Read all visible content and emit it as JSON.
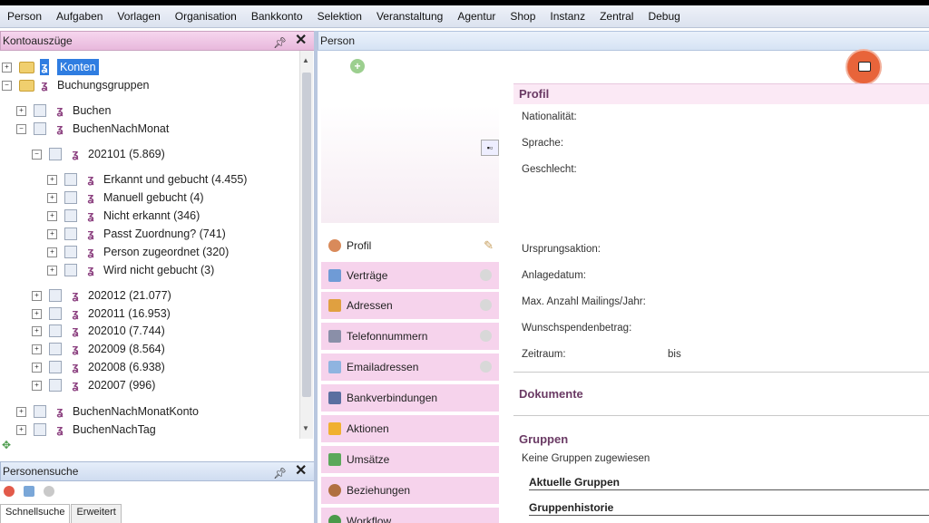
{
  "menu": [
    "Person",
    "Aufgaben",
    "Vorlagen",
    "Organisation",
    "Bankkonto",
    "Selektion",
    "Veranstaltung",
    "Agentur",
    "Shop",
    "Instanz",
    "Zentral",
    "Debug"
  ],
  "left_panel": {
    "title": "Kontoauszüge",
    "tree": [
      {
        "label": "Konten",
        "level": 0,
        "selected": true
      },
      {
        "label": "Buchungsgruppen",
        "level": 0
      },
      {
        "label": "Buchen",
        "level": 1
      },
      {
        "label": "BuchenNachMonat",
        "level": 1
      },
      {
        "label": "202101 (5.869)",
        "level": 2
      },
      {
        "label": "Erkannt und gebucht (4.455)",
        "level": 3
      },
      {
        "label": "Manuell gebucht (4)",
        "level": 3
      },
      {
        "label": "Nicht erkannt (346)",
        "level": 3
      },
      {
        "label": "Passt Zuordnung? (741)",
        "level": 3
      },
      {
        "label": "Person zugeordnet (320)",
        "level": 3
      },
      {
        "label": "Wird nicht gebucht (3)",
        "level": 3
      },
      {
        "label": "202012 (21.077)",
        "level": 2
      },
      {
        "label": "202011 (16.953)",
        "level": 2
      },
      {
        "label": "202010 (7.744)",
        "level": 2
      },
      {
        "label": "202009 (8.564)",
        "level": 2
      },
      {
        "label": "202008 (6.938)",
        "level": 2
      },
      {
        "label": "202007 (996)",
        "level": 2
      },
      {
        "label": "BuchenNachMonatKonto",
        "level": 1
      },
      {
        "label": "BuchenNachTag",
        "level": 1
      }
    ]
  },
  "search_panel": {
    "title": "Personensuche",
    "tabs": [
      "Schnellsuche",
      "Erweitert"
    ]
  },
  "person_panel": {
    "title": "Person",
    "nav": [
      "Profil",
      "Verträge",
      "Adressen",
      "Telefonnummern",
      "Emailadressen",
      "Bankverbindungen",
      "Aktionen",
      "Umsätze",
      "Beziehungen",
      "Workflow"
    ],
    "sections": {
      "profil": "Profil",
      "dokumente": "Dokumente",
      "gruppen": "Gruppen"
    },
    "fields": [
      "Nationalität:",
      "Sprache:",
      "Geschlecht:",
      "Ursprungsaktion:",
      "Anlagedatum:",
      "Max. Anzahl Mailings/Jahr:",
      "Wunschspendenbetrag:",
      "Zeitraum:"
    ],
    "bis": "bis",
    "no_groups": "Keine Gruppen zugewiesen",
    "current_groups": "Aktuelle Gruppen",
    "group_history": "Gruppenhistorie"
  },
  "colors": {
    "accent_pink": "#f6d3ec",
    "selection": "#2f7de1",
    "monitor_button": "#e8643a"
  }
}
